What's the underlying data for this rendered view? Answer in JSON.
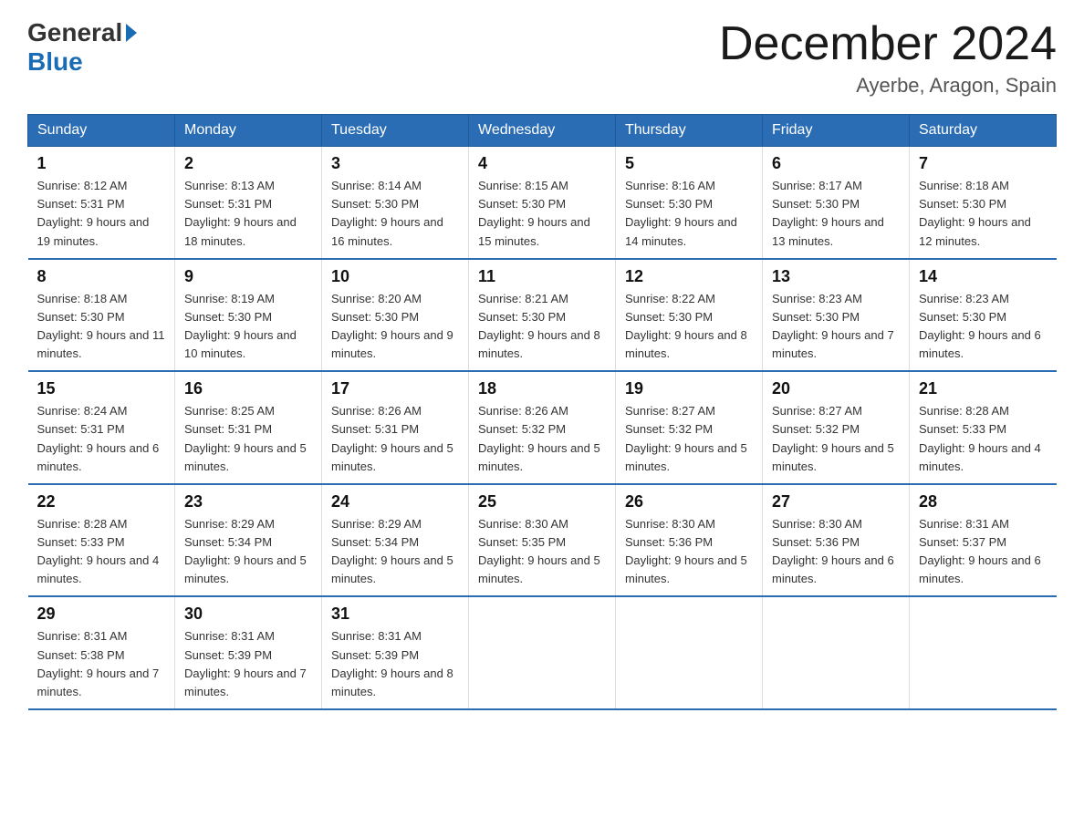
{
  "header": {
    "logo_general": "General",
    "logo_blue": "Blue",
    "month_title": "December 2024",
    "location": "Ayerbe, Aragon, Spain"
  },
  "days_of_week": [
    "Sunday",
    "Monday",
    "Tuesday",
    "Wednesday",
    "Thursday",
    "Friday",
    "Saturday"
  ],
  "weeks": [
    [
      {
        "day": "1",
        "sunrise": "8:12 AM",
        "sunset": "5:31 PM",
        "daylight": "9 hours and 19 minutes."
      },
      {
        "day": "2",
        "sunrise": "8:13 AM",
        "sunset": "5:31 PM",
        "daylight": "9 hours and 18 minutes."
      },
      {
        "day": "3",
        "sunrise": "8:14 AM",
        "sunset": "5:30 PM",
        "daylight": "9 hours and 16 minutes."
      },
      {
        "day": "4",
        "sunrise": "8:15 AM",
        "sunset": "5:30 PM",
        "daylight": "9 hours and 15 minutes."
      },
      {
        "day": "5",
        "sunrise": "8:16 AM",
        "sunset": "5:30 PM",
        "daylight": "9 hours and 14 minutes."
      },
      {
        "day": "6",
        "sunrise": "8:17 AM",
        "sunset": "5:30 PM",
        "daylight": "9 hours and 13 minutes."
      },
      {
        "day": "7",
        "sunrise": "8:18 AM",
        "sunset": "5:30 PM",
        "daylight": "9 hours and 12 minutes."
      }
    ],
    [
      {
        "day": "8",
        "sunrise": "8:18 AM",
        "sunset": "5:30 PM",
        "daylight": "9 hours and 11 minutes."
      },
      {
        "day": "9",
        "sunrise": "8:19 AM",
        "sunset": "5:30 PM",
        "daylight": "9 hours and 10 minutes."
      },
      {
        "day": "10",
        "sunrise": "8:20 AM",
        "sunset": "5:30 PM",
        "daylight": "9 hours and 9 minutes."
      },
      {
        "day": "11",
        "sunrise": "8:21 AM",
        "sunset": "5:30 PM",
        "daylight": "9 hours and 8 minutes."
      },
      {
        "day": "12",
        "sunrise": "8:22 AM",
        "sunset": "5:30 PM",
        "daylight": "9 hours and 8 minutes."
      },
      {
        "day": "13",
        "sunrise": "8:23 AM",
        "sunset": "5:30 PM",
        "daylight": "9 hours and 7 minutes."
      },
      {
        "day": "14",
        "sunrise": "8:23 AM",
        "sunset": "5:30 PM",
        "daylight": "9 hours and 6 minutes."
      }
    ],
    [
      {
        "day": "15",
        "sunrise": "8:24 AM",
        "sunset": "5:31 PM",
        "daylight": "9 hours and 6 minutes."
      },
      {
        "day": "16",
        "sunrise": "8:25 AM",
        "sunset": "5:31 PM",
        "daylight": "9 hours and 5 minutes."
      },
      {
        "day": "17",
        "sunrise": "8:26 AM",
        "sunset": "5:31 PM",
        "daylight": "9 hours and 5 minutes."
      },
      {
        "day": "18",
        "sunrise": "8:26 AM",
        "sunset": "5:32 PM",
        "daylight": "9 hours and 5 minutes."
      },
      {
        "day": "19",
        "sunrise": "8:27 AM",
        "sunset": "5:32 PM",
        "daylight": "9 hours and 5 minutes."
      },
      {
        "day": "20",
        "sunrise": "8:27 AM",
        "sunset": "5:32 PM",
        "daylight": "9 hours and 5 minutes."
      },
      {
        "day": "21",
        "sunrise": "8:28 AM",
        "sunset": "5:33 PM",
        "daylight": "9 hours and 4 minutes."
      }
    ],
    [
      {
        "day": "22",
        "sunrise": "8:28 AM",
        "sunset": "5:33 PM",
        "daylight": "9 hours and 4 minutes."
      },
      {
        "day": "23",
        "sunrise": "8:29 AM",
        "sunset": "5:34 PM",
        "daylight": "9 hours and 5 minutes."
      },
      {
        "day": "24",
        "sunrise": "8:29 AM",
        "sunset": "5:34 PM",
        "daylight": "9 hours and 5 minutes."
      },
      {
        "day": "25",
        "sunrise": "8:30 AM",
        "sunset": "5:35 PM",
        "daylight": "9 hours and 5 minutes."
      },
      {
        "day": "26",
        "sunrise": "8:30 AM",
        "sunset": "5:36 PM",
        "daylight": "9 hours and 5 minutes."
      },
      {
        "day": "27",
        "sunrise": "8:30 AM",
        "sunset": "5:36 PM",
        "daylight": "9 hours and 6 minutes."
      },
      {
        "day": "28",
        "sunrise": "8:31 AM",
        "sunset": "5:37 PM",
        "daylight": "9 hours and 6 minutes."
      }
    ],
    [
      {
        "day": "29",
        "sunrise": "8:31 AM",
        "sunset": "5:38 PM",
        "daylight": "9 hours and 7 minutes."
      },
      {
        "day": "30",
        "sunrise": "8:31 AM",
        "sunset": "5:39 PM",
        "daylight": "9 hours and 7 minutes."
      },
      {
        "day": "31",
        "sunrise": "8:31 AM",
        "sunset": "5:39 PM",
        "daylight": "9 hours and 8 minutes."
      },
      null,
      null,
      null,
      null
    ]
  ]
}
